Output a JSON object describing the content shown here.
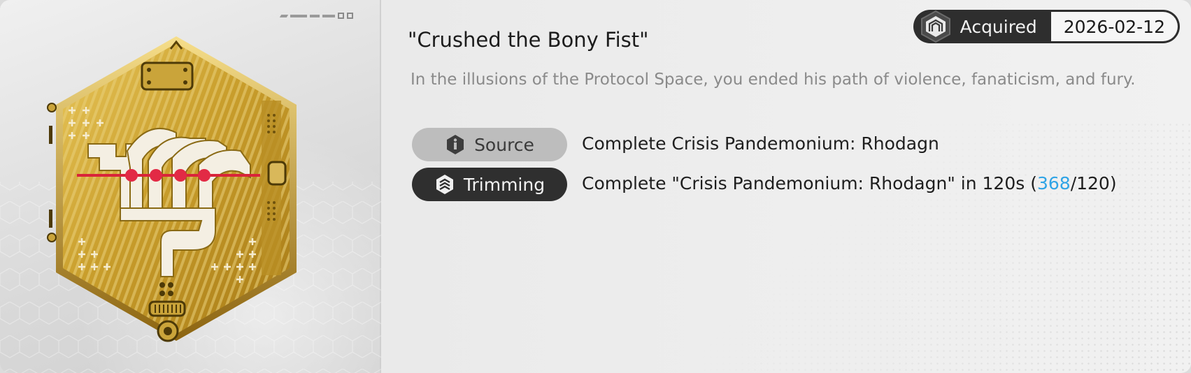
{
  "achievement": {
    "title": "\"Crushed the Bony Fist\"",
    "description": "In the illusions of the Protocol Space, you ended his path of violence, fanaticism, and fury."
  },
  "status": {
    "label": "Acquired",
    "date": "2026-02-12"
  },
  "requirements": {
    "source": {
      "label": "Source",
      "icon": "info-icon",
      "text": "Complete Crisis Pandemonium: Rhodagn"
    },
    "trimming": {
      "label": "Trimming",
      "icon": "trimming-icon",
      "text_prefix": "Complete \"Crisis Pandemonium: Rhodagn\" in 120s (",
      "progress_current": "368",
      "text_suffix": "/120)"
    }
  },
  "colors": {
    "highlight": "#2fa4e6",
    "medal_gold": "#c9a437",
    "badge_dark": "#2e2e2e"
  }
}
